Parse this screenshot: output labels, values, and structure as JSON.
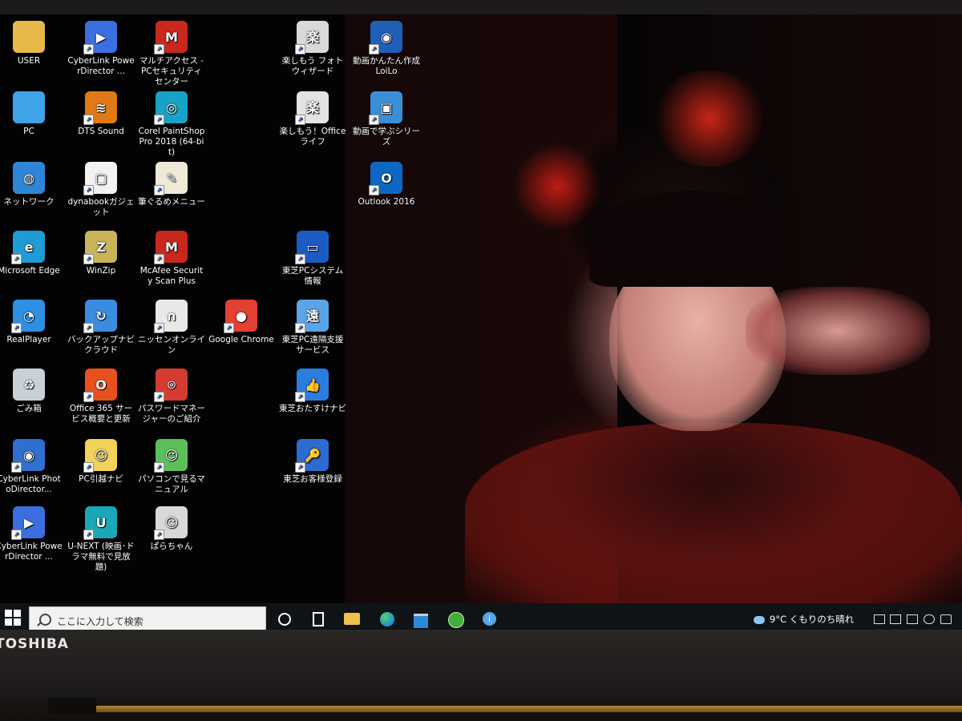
{
  "desktop": {
    "icons": [
      {
        "label": "USER",
        "icon": "user-folder-icon",
        "color": "#e7b94a",
        "glyph": ""
      },
      {
        "label": "CyberLink PowerDirector ...",
        "icon": "powerdirector-icon",
        "color": "#3b6fe0",
        "glyph": "▶"
      },
      {
        "label": "マルチアクセス - PCセキュリティセンター",
        "icon": "mcafee-icon",
        "color": "#c8281e",
        "glyph": "M"
      },
      {
        "label": "楽しもう フォト ウィザード",
        "icon": "photo-wizard-icon",
        "color": "#d9d9d9",
        "glyph": "楽"
      },
      {
        "label": "動画かんたん作成 LoiLo",
        "icon": "loilo-icon",
        "color": "#1e5fb8",
        "glyph": "◉"
      },
      {
        "label": "PC",
        "icon": "pc-icon",
        "color": "#3ea3e8",
        "glyph": ""
      },
      {
        "label": "DTS Sound",
        "icon": "dts-sound-icon",
        "color": "#e07a16",
        "glyph": "≋"
      },
      {
        "label": "Corel PaintShop Pro 2018 (64-bit)",
        "icon": "paintshop-icon",
        "color": "#18a2c7",
        "glyph": "◎"
      },
      {
        "label": "楽しもう！Office ライフ",
        "icon": "office-life-icon",
        "color": "#e3e3e3",
        "glyph": "楽"
      },
      {
        "label": "動画で学ぶシリーズ",
        "icon": "video-learning-icon",
        "color": "#3a8fd6",
        "glyph": "▣"
      },
      {
        "label": "ネットワーク",
        "icon": "network-icon",
        "color": "#2e86d9",
        "glyph": "◍"
      },
      {
        "label": "dynabookガジェット",
        "icon": "dynabook-gadget-icon",
        "color": "#f2f2f2",
        "glyph": "▢"
      },
      {
        "label": "筆ぐるめメニュー",
        "icon": "hudegurume-icon",
        "color": "#efe9d8",
        "glyph": "✎"
      },
      {
        "label": "Outlook 2016",
        "icon": "outlook-icon",
        "color": "#0f67c4",
        "glyph": "O"
      },
      {
        "label": "Microsoft Edge",
        "icon": "edge-icon",
        "color": "#1f9bd6",
        "glyph": "e"
      },
      {
        "label": "WinZip",
        "icon": "winzip-icon",
        "color": "#c9b45a",
        "glyph": "Z"
      },
      {
        "label": "McAfee Security Scan Plus",
        "icon": "mcafee-scan-icon",
        "color": "#c8281e",
        "glyph": "M"
      },
      {
        "label": "東芝PCシステム情報",
        "icon": "toshiba-system-info-icon",
        "color": "#1a5cc4",
        "glyph": "▭"
      },
      {
        "label": "RealPlayer",
        "icon": "realplayer-icon",
        "color": "#2f8fe3",
        "glyph": "◔"
      },
      {
        "label": "バックアップナビ クラウド",
        "icon": "backup-navi-icon",
        "color": "#3b8be0",
        "glyph": "↻"
      },
      {
        "label": "ニッセンオンライン",
        "icon": "nissen-icon",
        "color": "#e8e8e8",
        "glyph": "∩"
      },
      {
        "label": "Google Chrome",
        "icon": "chrome-icon",
        "color": "#e34133",
        "glyph": "●"
      },
      {
        "label": "東芝PC遠隔支援サービス",
        "icon": "toshiba-remote-icon",
        "color": "#5aa5e6",
        "glyph": "遠"
      },
      {
        "label": "ごみ箱",
        "icon": "recycle-bin-icon",
        "color": "#c8d0d8",
        "glyph": "♻"
      },
      {
        "label": "Office 365 サービス概要と更新",
        "icon": "office365-icon",
        "color": "#e8501e",
        "glyph": "O"
      },
      {
        "label": "パスワードマネージャーのご紹介",
        "icon": "password-manager-icon",
        "color": "#d43c2f",
        "glyph": "⌾"
      },
      {
        "label": "東芝おたすけナビ",
        "icon": "otasuke-navi-icon",
        "color": "#2b7de0",
        "glyph": "👍"
      },
      {
        "label": "CyberLink PhotoDirector...",
        "icon": "photodirector-icon",
        "color": "#2f6fcf",
        "glyph": "◉"
      },
      {
        "label": "PC引越ナビ",
        "icon": "pc-hikkoshi-icon",
        "color": "#f1d35a",
        "glyph": "☺"
      },
      {
        "label": "パソコンで見るマニュアル",
        "icon": "pc-manual-icon",
        "color": "#5bbf5a",
        "glyph": "☺"
      },
      {
        "label": "東芝お客様登録",
        "icon": "toshiba-registration-icon",
        "color": "#2d6bd0",
        "glyph": "🔑"
      },
      {
        "label": "CyberLink PowerDirector ...",
        "icon": "powerdirector-icon",
        "color": "#3b6fe0",
        "glyph": "▶"
      },
      {
        "label": "U-NEXT (映画･ドラマ無料で見放題)",
        "icon": "u-next-icon",
        "color": "#1aa7b8",
        "glyph": "U"
      },
      {
        "label": "ぱらちゃん",
        "icon": "parachan-icon",
        "color": "#d8d8d8",
        "glyph": "☺"
      }
    ]
  },
  "taskbar": {
    "search_placeholder": "ここに入力して検索",
    "pinned": [
      "cortana-icon",
      "task-view-icon",
      "file-explorer-icon",
      "edge-icon",
      "store-icon",
      "green-app-icon",
      "info-app-icon"
    ],
    "weather": "9°C くもりのち晴れ"
  },
  "bezel": {
    "brand": "TOSHIBA"
  }
}
